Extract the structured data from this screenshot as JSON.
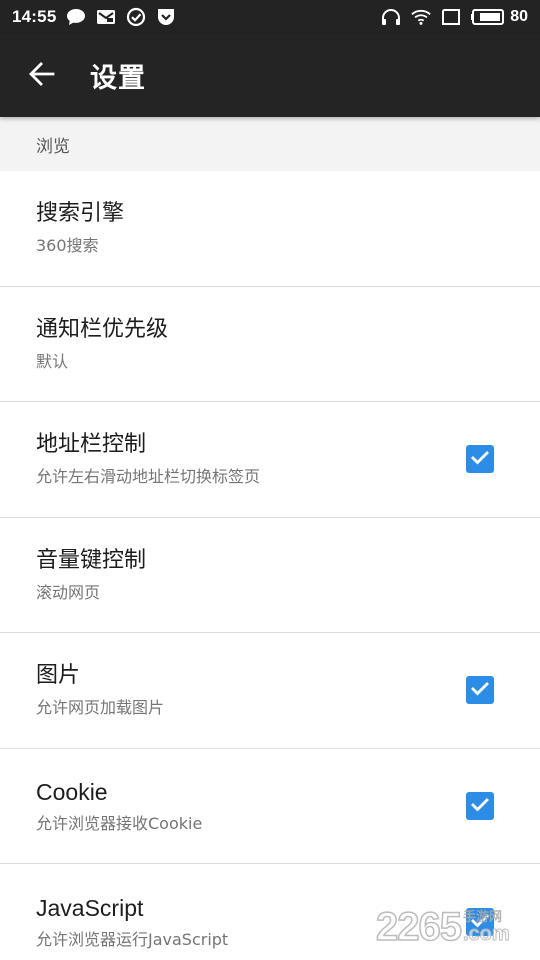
{
  "status_bar": {
    "time": "14:55",
    "left_icons": [
      "chat-bubble-icon",
      "mail-icon",
      "check-circle-icon",
      "pocket-icon"
    ],
    "right_icons": [
      "headphones-icon",
      "wifi-icon",
      "screen-icon"
    ],
    "battery_level": "80"
  },
  "app_bar": {
    "title": "设置",
    "back_icon": "arrow-left-icon"
  },
  "section": {
    "header": "浏览"
  },
  "settings": [
    {
      "title": "搜索引擎",
      "subtitle": "360搜索",
      "checkbox": false
    },
    {
      "title": "通知栏优先级",
      "subtitle": "默认",
      "checkbox": false
    },
    {
      "title": "地址栏控制",
      "subtitle": "允许左右滑动地址栏切换标签页",
      "checkbox": true,
      "checked": true
    },
    {
      "title": "音量键控制",
      "subtitle": "滚动网页",
      "checkbox": false
    },
    {
      "title": "图片",
      "subtitle": "允许网页加载图片",
      "checkbox": true,
      "checked": true
    },
    {
      "title": "Cookie",
      "subtitle": "允许浏览器接收Cookie",
      "checkbox": true,
      "checked": true
    },
    {
      "title": "JavaScript",
      "subtitle": "允许浏览器运行JavaScript",
      "checkbox": true,
      "checked": true
    }
  ],
  "watermark": {
    "digits": "2265",
    "cn": "手游网",
    "com": ".com"
  },
  "colors": {
    "status_bar_bg": "#232323",
    "app_bar_bg": "#242424",
    "section_bg": "#f3f3f3",
    "checkbox_accent": "#2b8de6"
  }
}
